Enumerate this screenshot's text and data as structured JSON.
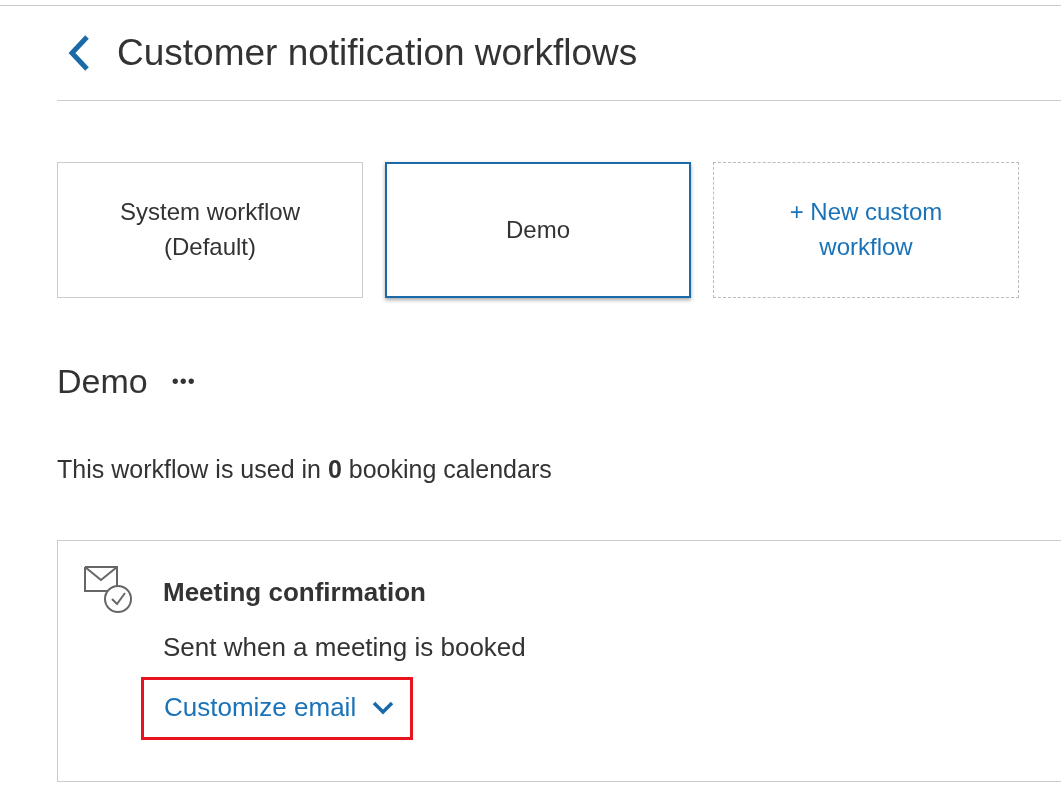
{
  "header": {
    "title": "Customer notification workflows"
  },
  "workflow_tabs": [
    {
      "lines": [
        "System workflow",
        "(Default)"
      ],
      "kind": "workflow",
      "selected": false
    },
    {
      "lines": [
        "Demo"
      ],
      "kind": "workflow",
      "selected": true
    },
    {
      "lines": [
        "+ New custom",
        "workflow"
      ],
      "kind": "new",
      "selected": false
    }
  ],
  "workflow": {
    "name": "Demo",
    "more": "•••",
    "usage": "This workflow is used in **0** booking calendars"
  },
  "notifications": [
    {
      "title": "Meeting confirmation",
      "description": "Sent when a meeting is booked",
      "link": "Customize email",
      "highlighted": true
    }
  ]
}
